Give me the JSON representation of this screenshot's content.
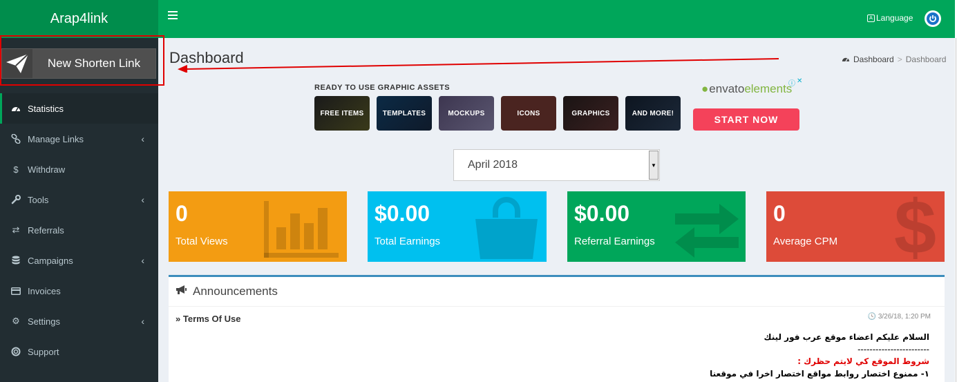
{
  "app": {
    "title": "Arap4link"
  },
  "header": {
    "language_label": "Language"
  },
  "sidebar": {
    "new_link_label": "New Shorten Link",
    "items": [
      {
        "label": "Statistics",
        "icon": "dashboard-icon"
      },
      {
        "label": "Manage Links",
        "icon": "link-icon"
      },
      {
        "label": "Withdraw",
        "icon": "dollar-icon"
      },
      {
        "label": "Tools",
        "icon": "wrench-icon"
      },
      {
        "label": "Referrals",
        "icon": "exchange-icon"
      },
      {
        "label": "Campaigns",
        "icon": "database-icon"
      },
      {
        "label": "Invoices",
        "icon": "credit-card-icon"
      },
      {
        "label": "Settings",
        "icon": "gears-icon"
      },
      {
        "label": "Support",
        "icon": "life-ring-icon"
      }
    ]
  },
  "page": {
    "title": "Dashboard",
    "breadcrumb": [
      "Dashboard",
      "Dashboard"
    ]
  },
  "ad": {
    "headline": "READY TO USE GRAPHIC ASSETS",
    "tiles": [
      "FREE ITEMS",
      "TEMPLATES",
      "MOCKUPS",
      "ICONS",
      "GRAPHICS",
      "AND MORE!"
    ],
    "brand_a": "envato",
    "brand_b": "elements",
    "cta": "START NOW"
  },
  "filter": {
    "month": "April 2018"
  },
  "stats": [
    {
      "value": "0",
      "label": "Total Views",
      "color": "#f39c12"
    },
    {
      "value": "$0.00",
      "label": "Total Earnings",
      "color": "#00c0ef"
    },
    {
      "value": "$0.00",
      "label": "Referral Earnings",
      "color": "#00a65a"
    },
    {
      "value": "0",
      "label": "Average CPM",
      "color": "#dd4b39"
    }
  ],
  "announcements": {
    "title": "Announcements",
    "item_title": "Terms Of Use",
    "item_date": "3/26/18, 1:20 PM",
    "lines": [
      "السلام عليكم اعضاء موقع عرب فور لينك",
      "------------------------",
      "شروط الموقع كي لايتم حظرك :",
      "١- ممنوع اختصار روابط مواقع اختصار اخرا في موقعنا"
    ]
  },
  "colors": {
    "brand_green": "#00a65a",
    "sidebar_bg": "#222d32",
    "annotation_red": "#e00000"
  }
}
